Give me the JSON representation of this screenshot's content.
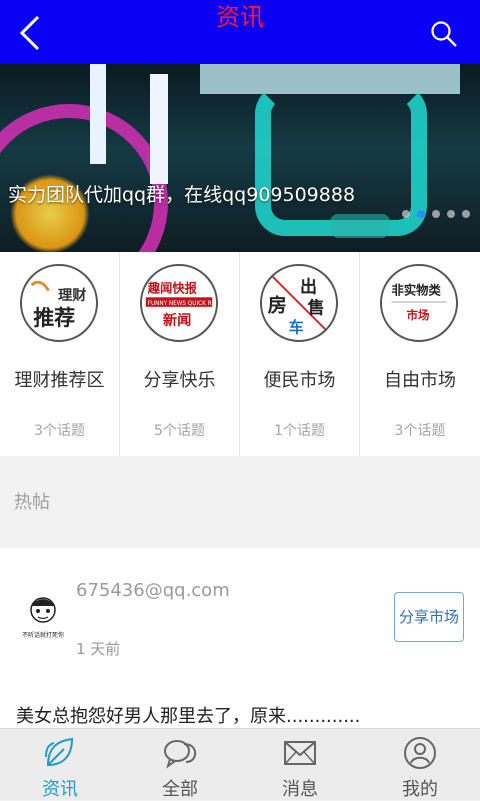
{
  "header": {
    "title": "资讯",
    "back_icon": "back-chevron-icon",
    "search_icon": "search-icon",
    "background_color": "#0a00f5",
    "title_color": "#ff1a2e"
  },
  "banner": {
    "caption": "实力团队代加qq群，在线qq909509888",
    "dot_count": 5,
    "active_dot": 1
  },
  "categories": [
    {
      "name": "理财推荐区",
      "count": "3个话题",
      "logo_text": [
        "理财",
        "推荐"
      ]
    },
    {
      "name": "分享快乐",
      "count": "5个话题",
      "logo_text": [
        "趣闻快报",
        "FUNNY NEWS QUICK R",
        "新闻"
      ]
    },
    {
      "name": "便民市场",
      "count": "1个话题",
      "logo_text": [
        "房",
        "出",
        "售",
        "车"
      ]
    },
    {
      "name": "自由市场",
      "count": "3个话题",
      "logo_text": [
        "非实物类",
        "市场"
      ]
    }
  ],
  "hot_section": {
    "label": "热帖"
  },
  "post": {
    "author": "675436@qq.com",
    "avatar_caption": "不听话就打死你",
    "time": "1 天前",
    "tag": "分享市场",
    "title": "美女总抱怨好男人那里去了，原来............."
  },
  "tabbar": {
    "items": [
      {
        "label": "资讯",
        "icon": "leaf-icon",
        "active": true
      },
      {
        "label": "全部",
        "icon": "chat-bubbles-icon",
        "active": false
      },
      {
        "label": "消息",
        "icon": "envelope-icon",
        "active": false
      },
      {
        "label": "我的",
        "icon": "user-icon",
        "active": false
      }
    ],
    "active_color": "#1f9cc6"
  }
}
